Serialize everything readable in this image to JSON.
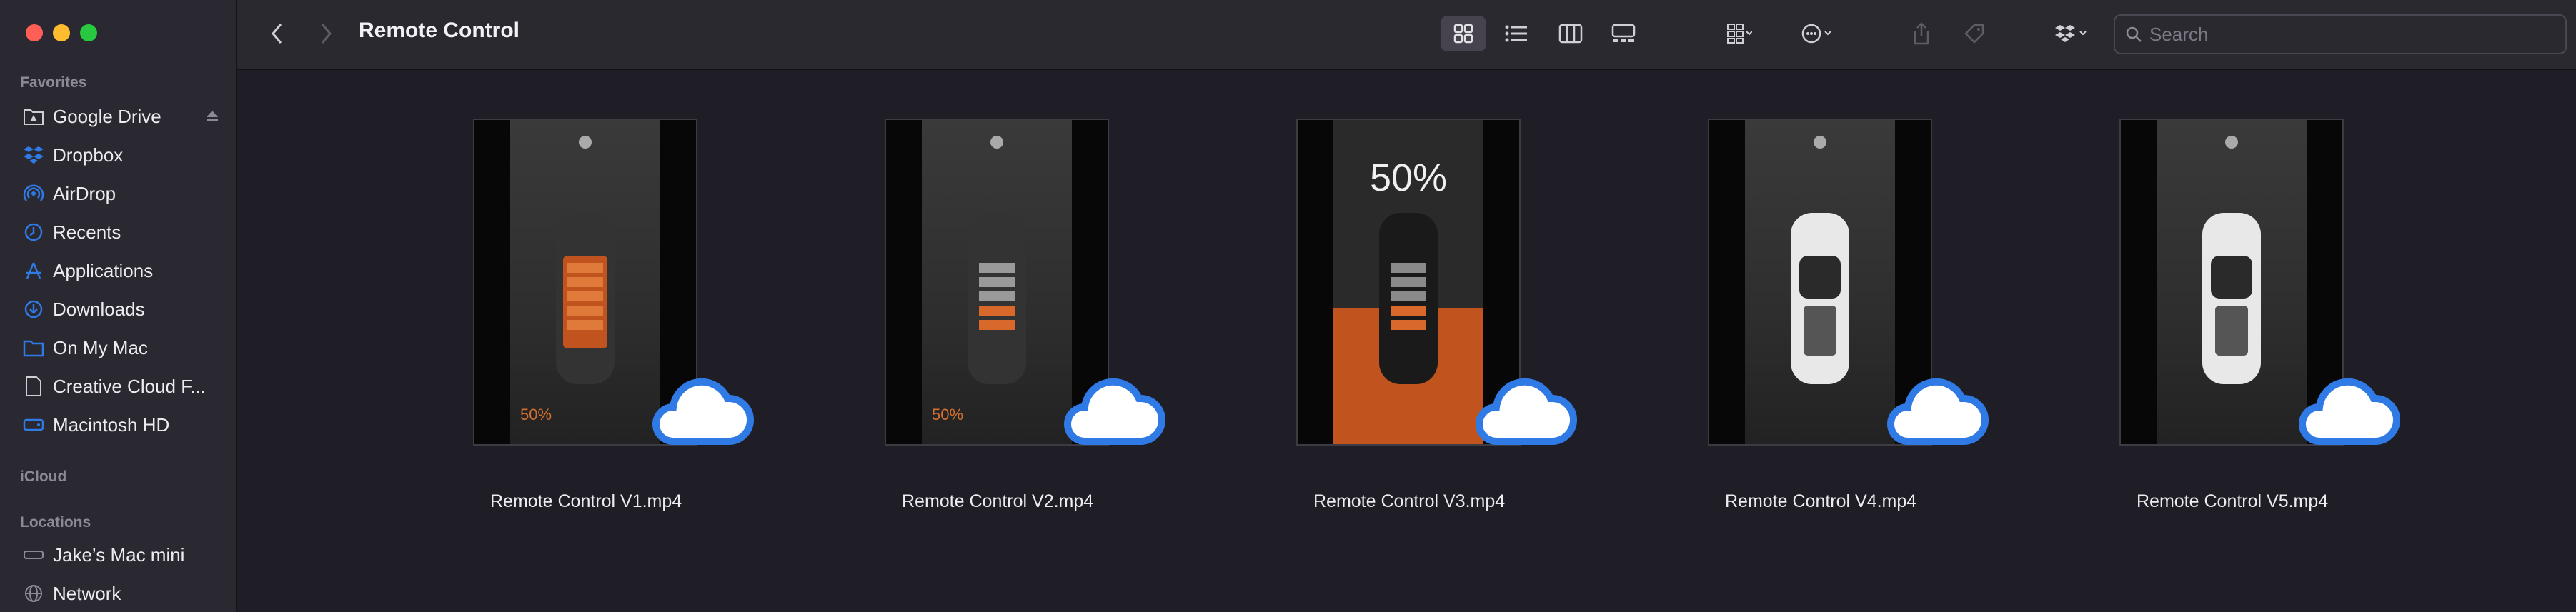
{
  "window": {
    "title": "Remote Control"
  },
  "sidebar": {
    "favorites_title": "Favorites",
    "favorites": [
      {
        "label": "Google Drive",
        "icon": "drive-folder-icon"
      },
      {
        "label": "Dropbox",
        "icon": "dropbox-icon"
      },
      {
        "label": "AirDrop",
        "icon": "airdrop-icon"
      },
      {
        "label": "Recents",
        "icon": "clock-icon"
      },
      {
        "label": "Applications",
        "icon": "applications-icon"
      },
      {
        "label": "Downloads",
        "icon": "download-icon"
      },
      {
        "label": "On My Mac",
        "icon": "folder-icon"
      },
      {
        "label": "Creative Cloud F...",
        "icon": "document-icon"
      },
      {
        "label": "Macintosh HD",
        "icon": "disk-icon"
      }
    ],
    "icloud_title": "iCloud",
    "locations_title": "Locations",
    "locations": [
      {
        "label": "Jake’s Mac mini",
        "icon": "computer-icon"
      },
      {
        "label": "Network",
        "icon": "globe-icon"
      }
    ]
  },
  "search": {
    "placeholder": "Search"
  },
  "files": [
    {
      "name": "Remote Control V1.mp4",
      "thumb_label": "50%",
      "variant": "orange"
    },
    {
      "name": "Remote Control V2.mp4",
      "thumb_label": "50%",
      "variant": "gray"
    },
    {
      "name": "Remote Control V3.mp4",
      "thumb_label": "50%",
      "variant": "charging"
    },
    {
      "name": "Remote Control V4.mp4",
      "thumb_label": "",
      "variant": "white"
    },
    {
      "name": "Remote Control V5.mp4",
      "thumb_label": "",
      "variant": "white"
    }
  ],
  "colors": {
    "accent": "#2f7ae5",
    "orange": "#c0531e"
  }
}
